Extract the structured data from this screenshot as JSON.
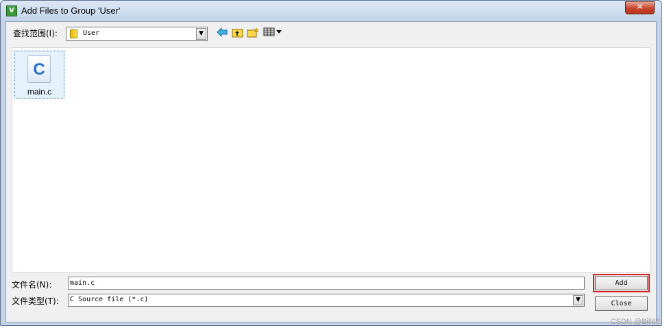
{
  "window": {
    "title": "Add Files to Group 'User'",
    "close_glyph": "✕"
  },
  "app_icon": {
    "name": "uvision-icon",
    "glyph": "V"
  },
  "look_in": {
    "label": "查找范围(I):",
    "value": "User"
  },
  "toolbar": {
    "back_icon": "back-arrow-icon",
    "up_folder_icon": "up-folder-icon",
    "new_folder_icon": "new-folder-icon",
    "view_menu_icon": "view-menu-icon"
  },
  "files": [
    {
      "name": "main.c",
      "icon": "c-source-file-icon",
      "icon_glyph": "C",
      "selected": true
    }
  ],
  "file_name": {
    "label": "文件名(N):",
    "value": "main.c"
  },
  "file_type": {
    "label": "文件类型(T):",
    "value": "C Source file (*.c)"
  },
  "buttons": {
    "add": "Add",
    "close": "Close"
  },
  "watermark": "CSDN @Bill66",
  "colors": {
    "accent_highlight": "#d81e1e",
    "selection": "#e5f1fb",
    "title_close": "#c7432a"
  }
}
